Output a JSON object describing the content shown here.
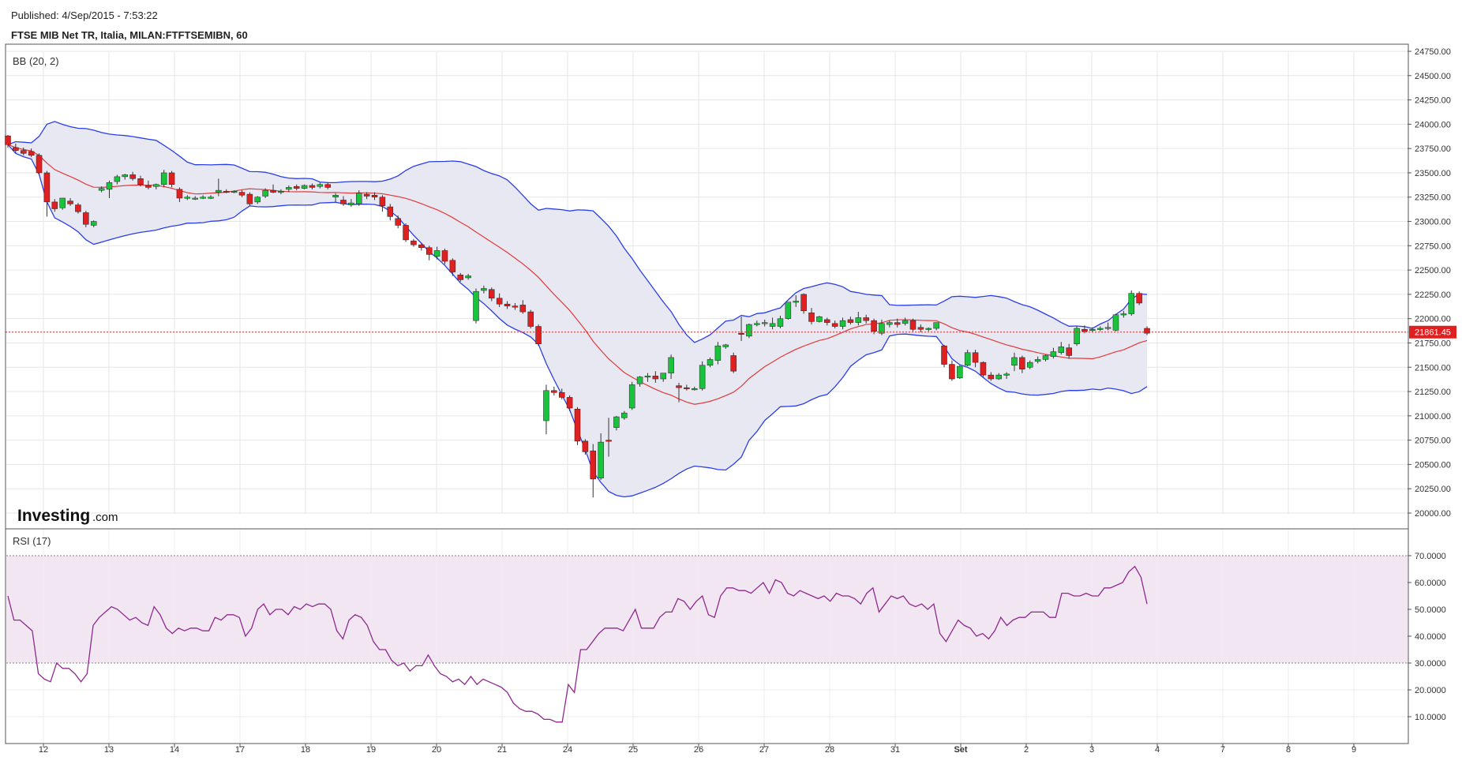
{
  "header": {
    "published": "Published: 4/Sep/2015 - 7:53:22",
    "title": "FTSE MIB Net TR, Italia, MILAN:FTFTSEMIBN, 60"
  },
  "logo": {
    "main": "Investing",
    "suffix": ".com"
  },
  "colors": {
    "up": "#19c33c",
    "down": "#e02020",
    "bb_band": "#2a3ee8",
    "bb_mid": "#e23a3a",
    "bb_fill": "#e8e8f3",
    "rsi_line": "#8e2a8e",
    "rsi_zone": "#f2e6f2",
    "price_line": "#e02020"
  },
  "chart_data": [
    {
      "type": "candlestick",
      "indicator_label": "BB (20, 2)",
      "ylim": [
        20000,
        24750
      ],
      "y_ticks": [
        "24750.00",
        "24500.00",
        "24250.00",
        "24000.00",
        "23750.00",
        "23500.00",
        "23250.00",
        "23000.00",
        "22750.00",
        "22500.00",
        "22250.00",
        "22000.00",
        "21750.00",
        "21500.00",
        "21250.00",
        "21000.00",
        "20750.00",
        "20500.00",
        "20250.00",
        "20000.00"
      ],
      "x_tick_labels": [
        "12",
        "13",
        "14",
        "17",
        "18",
        "19",
        "20",
        "21",
        "24",
        "25",
        "26",
        "27",
        "28",
        "31",
        "Set",
        "2",
        "3",
        "4",
        "7",
        "8",
        "9"
      ],
      "last_price_label": "21861.45",
      "last_price": 21861.45,
      "candles": [
        [
          23880,
          23890,
          23790,
          23760
        ],
        [
          23760,
          23800,
          23730,
          23700
        ],
        [
          23730,
          23760,
          23700,
          23680
        ],
        [
          23720,
          23750,
          23680,
          23660
        ],
        [
          23680,
          23700,
          23500,
          23480
        ],
        [
          23500,
          23520,
          23200,
          23050
        ],
        [
          23200,
          23230,
          23130,
          23100
        ],
        [
          23140,
          23230,
          23240,
          23120
        ],
        [
          23210,
          23240,
          23180,
          23160
        ],
        [
          23170,
          23190,
          23100,
          23080
        ],
        [
          23090,
          23110,
          22970,
          22940
        ],
        [
          22960,
          23010,
          23000,
          22940
        ],
        [
          23320,
          23360,
          23340,
          23300
        ],
        [
          23330,
          23420,
          23400,
          23240
        ],
        [
          23410,
          23480,
          23460,
          23380
        ],
        [
          23460,
          23490,
          23480,
          23430
        ],
        [
          23480,
          23510,
          23440,
          23420
        ],
        [
          23440,
          23470,
          23380,
          23360
        ],
        [
          23370,
          23420,
          23350,
          23330
        ],
        [
          23360,
          23390,
          23380,
          23330
        ],
        [
          23380,
          23530,
          23500,
          23350
        ],
        [
          23500,
          23520,
          23380,
          23350
        ],
        [
          23330,
          23350,
          23240,
          23200
        ],
        [
          23240,
          23270,
          23250,
          23220
        ],
        [
          23240,
          23260,
          23240,
          23220
        ],
        [
          23240,
          23270,
          23250,
          23230
        ],
        [
          23250,
          23270,
          23250,
          23230
        ],
        [
          23300,
          23440,
          23320,
          23260
        ],
        [
          23310,
          23330,
          23300,
          23290
        ],
        [
          23300,
          23320,
          23310,
          23290
        ],
        [
          23300,
          23320,
          23270,
          23250
        ],
        [
          23280,
          23300,
          23180,
          23160
        ],
        [
          23200,
          23260,
          23250,
          23180
        ],
        [
          23260,
          23340,
          23320,
          23240
        ],
        [
          23320,
          23380,
          23300,
          23290
        ],
        [
          23300,
          23330,
          23310,
          23280
        ],
        [
          23330,
          23370,
          23350,
          23300
        ],
        [
          23360,
          23380,
          23340,
          23320
        ],
        [
          23340,
          23380,
          23370,
          23330
        ],
        [
          23370,
          23390,
          23350,
          23330
        ],
        [
          23360,
          23400,
          23380,
          23340
        ],
        [
          23380,
          23400,
          23350,
          23330
        ],
        [
          23250,
          23290,
          23270,
          23200
        ],
        [
          23220,
          23260,
          23180,
          23160
        ],
        [
          23170,
          23230,
          23190,
          23150
        ],
        [
          23180,
          23320,
          23290,
          23160
        ],
        [
          23280,
          23300,
          23260,
          23230
        ],
        [
          23270,
          23300,
          23250,
          23220
        ],
        [
          23250,
          23270,
          23160,
          23100
        ],
        [
          23150,
          23180,
          23050,
          23010
        ],
        [
          23030,
          23060,
          22960,
          22930
        ],
        [
          22960,
          22980,
          22810,
          22790
        ],
        [
          22800,
          22820,
          22760,
          22740
        ],
        [
          22760,
          22780,
          22730,
          22700
        ],
        [
          22730,
          22750,
          22660,
          22600
        ],
        [
          22640,
          22740,
          22700,
          22610
        ],
        [
          22700,
          22720,
          22590,
          22560
        ],
        [
          22600,
          22620,
          22480,
          22440
        ],
        [
          22450,
          22470,
          22400,
          22380
        ],
        [
          22420,
          22460,
          22440,
          22400
        ],
        [
          21980,
          22310,
          22280,
          21950
        ],
        [
          22290,
          22340,
          22310,
          22260
        ],
        [
          22300,
          22320,
          22210,
          22180
        ],
        [
          22210,
          22260,
          22150,
          22120
        ],
        [
          22150,
          22180,
          22130,
          22100
        ],
        [
          22130,
          22160,
          22120,
          22090
        ],
        [
          22140,
          22190,
          22070,
          22050
        ],
        [
          22070,
          22090,
          21920,
          21900
        ],
        [
          21920,
          21940,
          21740,
          21720
        ],
        [
          20950,
          21320,
          21260,
          20810
        ],
        [
          21260,
          21300,
          21240,
          21210
        ],
        [
          21240,
          21280,
          21190,
          21170
        ],
        [
          21190,
          21210,
          21080,
          21050
        ],
        [
          21070,
          21090,
          20740,
          20700
        ],
        [
          20740,
          20760,
          20630,
          20600
        ],
        [
          20640,
          20710,
          20350,
          20160
        ],
        [
          20360,
          20820,
          20730,
          20340
        ],
        [
          20750,
          20980,
          20740,
          20580
        ],
        [
          20880,
          21000,
          20990,
          20850
        ],
        [
          20980,
          21050,
          21030,
          20960
        ],
        [
          21080,
          21350,
          21320,
          21060
        ],
        [
          21330,
          21410,
          21400,
          21300
        ],
        [
          21400,
          21440,
          21410,
          21350
        ],
        [
          21410,
          21460,
          21380,
          21340
        ],
        [
          21380,
          21430,
          21440,
          21350
        ],
        [
          21440,
          21630,
          21600,
          21380
        ],
        [
          21310,
          21340,
          21290,
          21140
        ],
        [
          21290,
          21320,
          21280,
          21260
        ],
        [
          21270,
          21300,
          21280,
          21260
        ],
        [
          21280,
          21560,
          21520,
          21260
        ],
        [
          21520,
          21600,
          21580,
          21500
        ],
        [
          21570,
          21760,
          21720,
          21530
        ],
        [
          21710,
          21740,
          21730,
          21690
        ],
        [
          21620,
          21650,
          21460,
          21440
        ],
        [
          21850,
          22020,
          21840,
          21770
        ],
        [
          21820,
          21950,
          21940,
          21800
        ],
        [
          21940,
          21980,
          21950,
          21920
        ],
        [
          21950,
          21990,
          21960,
          21920
        ],
        [
          21920,
          22010,
          21950,
          21890
        ],
        [
          21920,
          22030,
          22000,
          21900
        ],
        [
          22000,
          22140,
          22170,
          21990
        ],
        [
          22170,
          22240,
          22180,
          22120
        ],
        [
          22250,
          22260,
          22080,
          22050
        ],
        [
          22060,
          22110,
          21970,
          21940
        ],
        [
          21970,
          22030,
          22020,
          21960
        ],
        [
          21990,
          22010,
          21960,
          21930
        ],
        [
          21950,
          21980,
          21920,
          21900
        ],
        [
          21920,
          22010,
          21980,
          21890
        ],
        [
          21990,
          22020,
          21960,
          21940
        ],
        [
          21960,
          22070,
          22010,
          21930
        ],
        [
          22010,
          22040,
          21980,
          21950
        ],
        [
          21980,
          22000,
          21870,
          21840
        ],
        [
          21850,
          21990,
          21950,
          21830
        ],
        [
          21940,
          21980,
          21960,
          21910
        ],
        [
          21960,
          22000,
          21940,
          21910
        ],
        [
          21950,
          22010,
          21980,
          21930
        ],
        [
          21980,
          22000,
          21890,
          21870
        ],
        [
          21910,
          21940,
          21890,
          21860
        ],
        [
          21890,
          21910,
          21900,
          21870
        ],
        [
          21900,
          21950,
          21960,
          21880
        ],
        [
          21720,
          21730,
          21530,
          21500
        ],
        [
          21530,
          21570,
          21380,
          21360
        ],
        [
          21390,
          21520,
          21510,
          21380
        ],
        [
          21520,
          21680,
          21650,
          21510
        ],
        [
          21650,
          21680,
          21550,
          21500
        ],
        [
          21550,
          21560,
          21420,
          21400
        ],
        [
          21420,
          21450,
          21380,
          21360
        ],
        [
          21380,
          21440,
          21420,
          21370
        ],
        [
          21420,
          21450,
          21430,
          21380
        ],
        [
          21520,
          21650,
          21600,
          21460
        ],
        [
          21600,
          21620,
          21480,
          21440
        ],
        [
          21500,
          21570,
          21550,
          21480
        ],
        [
          21560,
          21610,
          21580,
          21540
        ],
        [
          21580,
          21630,
          21620,
          21560
        ],
        [
          21610,
          21700,
          21660,
          21590
        ],
        [
          21650,
          21760,
          21710,
          21630
        ],
        [
          21700,
          21740,
          21620,
          21590
        ],
        [
          21740,
          21920,
          21900,
          21720
        ],
        [
          21890,
          21930,
          21870,
          21850
        ],
        [
          21880,
          21910,
          21890,
          21860
        ],
        [
          21890,
          21920,
          21900,
          21870
        ],
        [
          21900,
          21960,
          21910,
          21880
        ],
        [
          21880,
          22050,
          22040,
          21870
        ],
        [
          22050,
          22080,
          22050,
          22010
        ],
        [
          22050,
          22290,
          22260,
          22030
        ],
        [
          22260,
          22280,
          22160,
          22140
        ],
        [
          21900,
          21920,
          21850,
          21830
        ]
      ]
    },
    {
      "type": "line",
      "indicator_label": "RSI (17)",
      "ylim": [
        0,
        80
      ],
      "zone": [
        30,
        70
      ],
      "y_ticks": [
        "70.0000",
        "60.0000",
        "50.0000",
        "40.0000",
        "30.0000",
        "20.0000",
        "10.0000"
      ],
      "values": [
        55,
        46,
        46,
        44,
        42,
        26,
        24,
        23,
        30,
        28,
        28,
        26,
        23,
        26,
        44,
        47,
        49,
        51,
        50,
        48,
        46,
        47,
        45,
        44,
        51,
        48,
        43,
        41,
        43,
        42,
        43,
        43,
        42,
        42,
        47,
        46,
        48,
        48,
        47,
        40,
        43,
        50,
        52,
        48,
        50,
        50,
        48,
        51,
        50,
        52,
        51,
        52,
        52,
        50,
        42,
        39,
        46,
        48,
        47,
        44,
        38,
        35,
        35,
        31,
        29,
        30,
        27,
        29,
        29,
        33,
        29,
        26,
        25,
        23,
        24,
        22,
        25,
        22,
        24,
        23,
        22,
        21,
        19,
        15,
        13,
        12,
        12,
        11,
        9,
        9,
        8,
        8,
        22,
        19,
        35,
        35,
        38,
        41,
        43,
        43,
        43,
        42,
        46,
        50,
        43,
        43,
        43,
        47,
        49,
        49,
        54,
        53,
        50,
        53,
        55,
        48,
        47,
        55,
        58,
        58,
        57,
        57,
        56,
        58,
        60,
        56,
        61,
        60,
        56,
        55,
        57,
        56,
        55,
        54,
        55,
        53,
        56,
        55,
        55,
        54,
        52,
        56,
        58,
        49,
        52,
        55,
        54,
        55,
        52,
        51,
        52,
        50,
        52,
        41,
        38,
        42,
        46,
        44,
        43,
        40,
        41,
        39,
        42,
        47,
        44,
        46,
        47,
        47,
        49,
        49,
        49,
        47,
        47,
        56,
        56,
        55,
        55,
        56,
        55,
        55,
        58,
        58,
        59,
        60,
        64,
        66,
        62,
        52
      ]
    }
  ]
}
